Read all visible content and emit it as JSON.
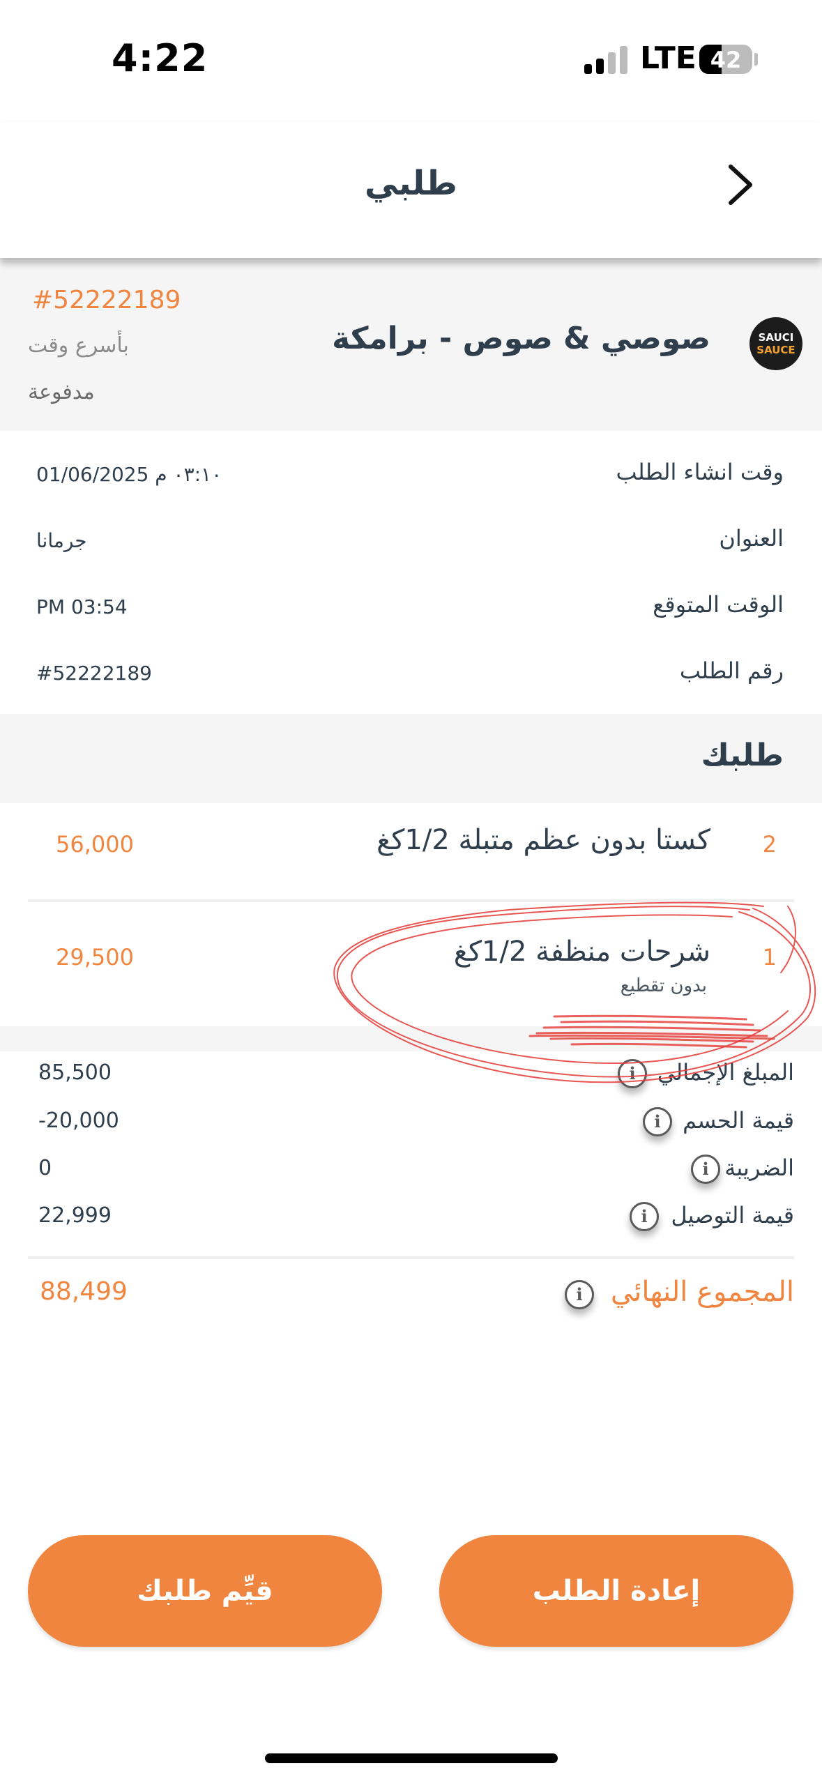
{
  "status_bar": {
    "time": "4:22",
    "network": "LTE",
    "battery": "42"
  },
  "header": {
    "title": "طلبي"
  },
  "restaurant": {
    "logo_line1": "SAUCI",
    "logo_line2": "SAUCE",
    "name": "صوصي & صوص - برامكة",
    "order_number": "#52222189",
    "delivery_speed": "بأسرع وقت",
    "payment_status": "مدفوعة"
  },
  "info": [
    {
      "label": "وقت انشاء الطلب",
      "value": "01/06/2025 ٠٣:١٠ م"
    },
    {
      "label": "العنوان",
      "value": "جرمانا"
    },
    {
      "label": "الوقت المتوقع",
      "value": "PM 03:54"
    },
    {
      "label": "رقم الطلب",
      "value": "#52222189"
    }
  ],
  "order_section": {
    "title": "طلبك"
  },
  "items": [
    {
      "qty": "2",
      "name": "كستا بدون عظم متبلة 1/2كغ",
      "note": "",
      "price": "56,000"
    },
    {
      "qty": "1",
      "name": "شرحات منظفة 1/2كغ",
      "note": "بدون  تقطيع",
      "price": "29,500"
    }
  ],
  "summary": [
    {
      "label": "المبلغ الإجمالي",
      "value": "85,500"
    },
    {
      "label": "قيمة الحسم",
      "value": "-20,000"
    },
    {
      "label": "الضريبة",
      "value": "0"
    },
    {
      "label": "قيمة التوصيل",
      "value": "22,999"
    }
  ],
  "total": {
    "label": "المجموع النهائي",
    "value": "88,499"
  },
  "buttons": {
    "rate": "قيِّم طلبك",
    "reorder": "إعادة الطلب"
  },
  "colors": {
    "accent": "#f08540",
    "text": "#2f3e4c",
    "section_bg": "#f5f5f5",
    "annotation": "#e53935"
  },
  "icons": {
    "back": "chevron-right-icon",
    "info": "info-icon"
  }
}
